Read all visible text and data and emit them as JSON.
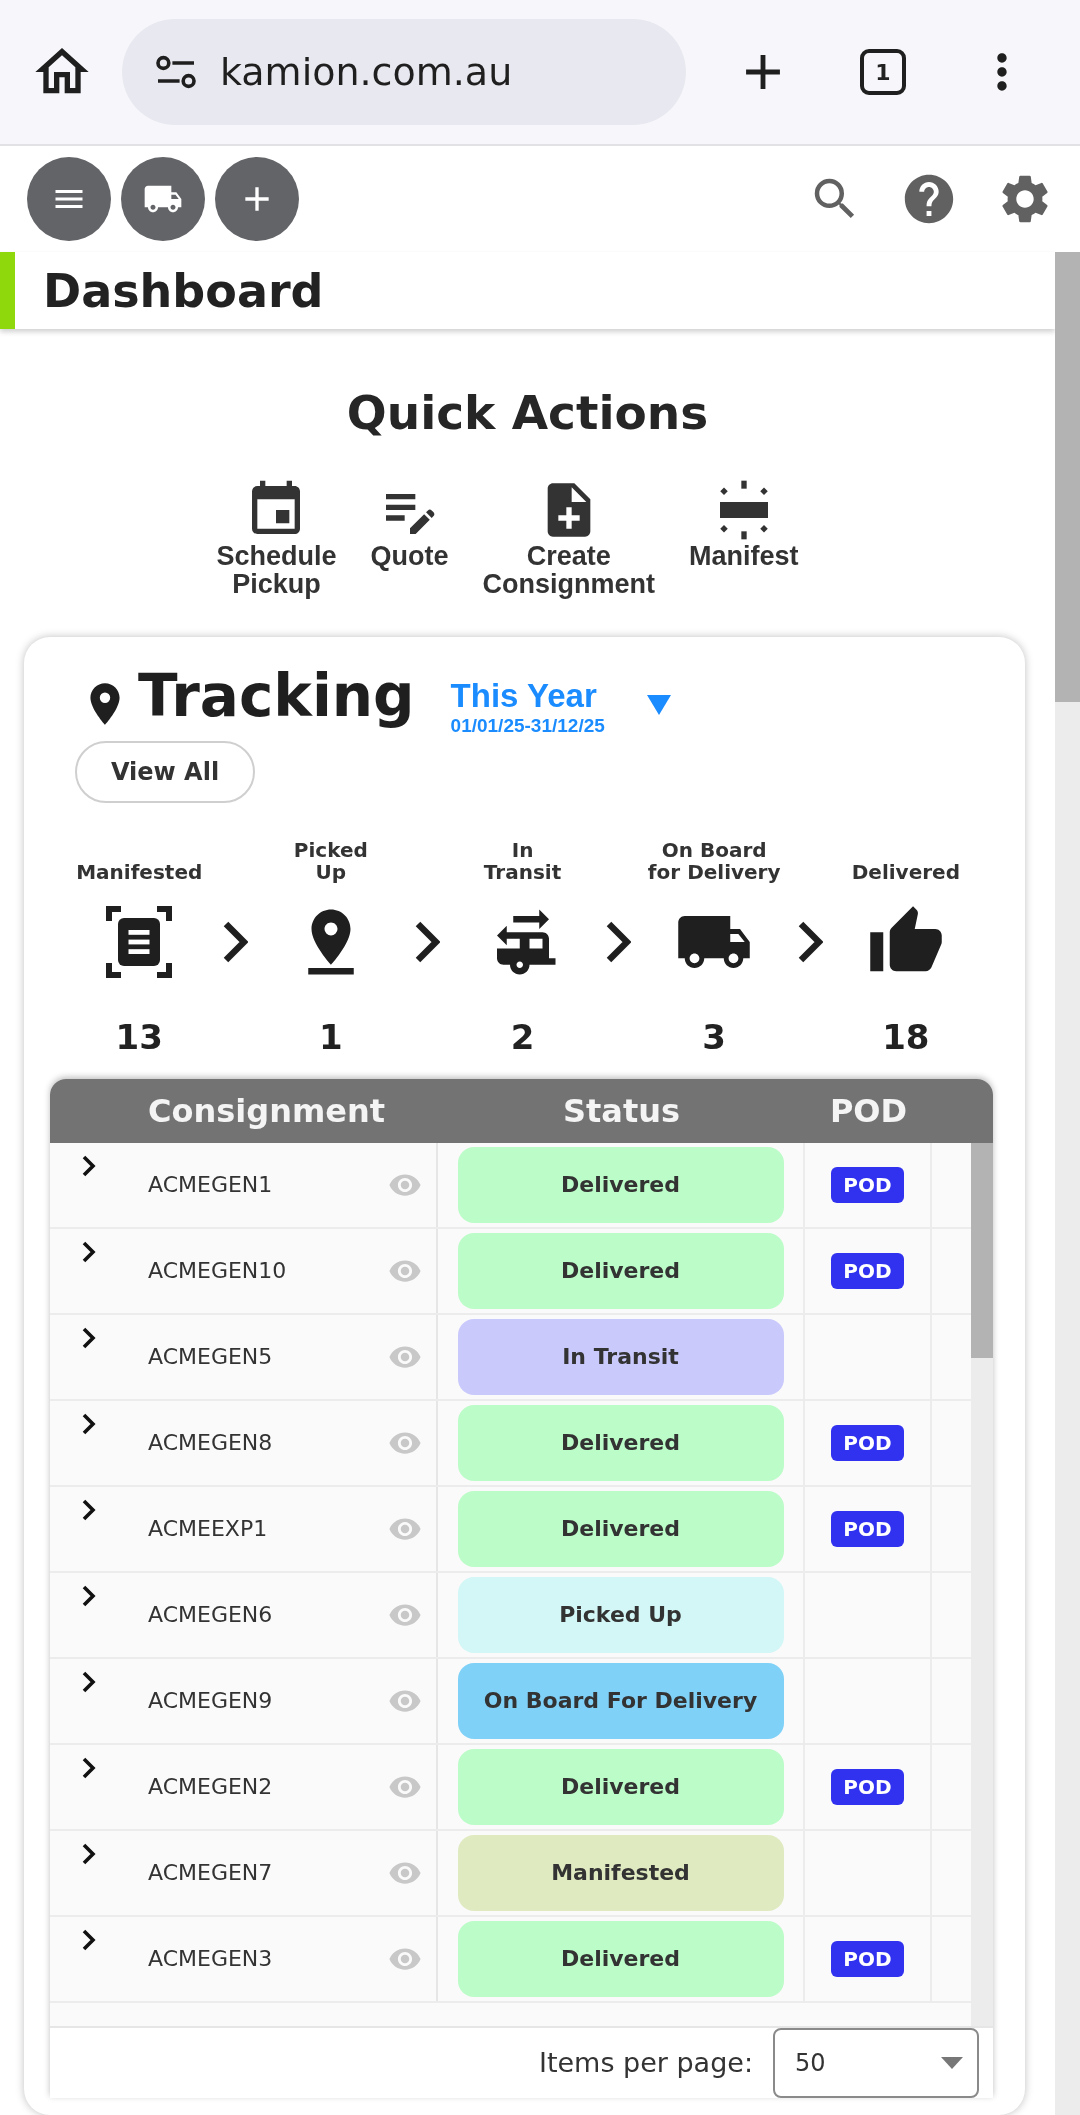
{
  "browser": {
    "url": "kamion.com.au",
    "tab_count": "1"
  },
  "page_title": "Dashboard",
  "quick_actions": {
    "title": "Quick Actions",
    "items": [
      {
        "kind": "schedule",
        "label": "Schedule Pickup"
      },
      {
        "kind": "quote",
        "label": "Quote"
      },
      {
        "kind": "create",
        "label": "Create Consignment"
      },
      {
        "kind": "manifest",
        "label": "Manifest"
      }
    ]
  },
  "tracking": {
    "title": "Tracking",
    "period": "This Year",
    "date_range": "01/01/25-31/12/25",
    "view_all": "View All",
    "steps": [
      {
        "kind": "manifested",
        "label": "Manifested",
        "count": "13"
      },
      {
        "kind": "picked_up",
        "label": "Picked\nUp",
        "count": "1"
      },
      {
        "kind": "in_transit",
        "label": "In\nTransit",
        "count": "2"
      },
      {
        "kind": "on_board",
        "label": "On Board\nfor Delivery",
        "count": "3"
      },
      {
        "kind": "delivered",
        "label": "Delivered",
        "count": "18"
      }
    ],
    "table": {
      "columns": [
        "Consignment",
        "Status",
        "POD"
      ],
      "rows": [
        {
          "consignment": "ACMEGEN1",
          "status": "Delivered",
          "color": "#bcfcc8",
          "pod": "POD"
        },
        {
          "consignment": "ACMEGEN10",
          "status": "Delivered",
          "color": "#bcfcc8",
          "pod": "POD"
        },
        {
          "consignment": "ACMEGEN5",
          "status": "In Transit",
          "color": "#c9c9fc"
        },
        {
          "consignment": "ACMEGEN8",
          "status": "Delivered",
          "color": "#bcfcc8",
          "pod": "POD"
        },
        {
          "consignment": "ACMEEXP1",
          "status": "Delivered",
          "color": "#bcfcc8",
          "pod": "POD"
        },
        {
          "consignment": "ACMEGEN6",
          "status": "Picked Up",
          "color": "#d3f6f6"
        },
        {
          "consignment": "ACMEGEN9",
          "status": "On Board For Delivery",
          "color": "#80d1f8"
        },
        {
          "consignment": "ACMEGEN2",
          "status": "Delivered",
          "color": "#bcfcc8",
          "pod": "POD"
        },
        {
          "consignment": "ACMEGEN7",
          "status": "Manifested",
          "color": "#dfeac1"
        },
        {
          "consignment": "ACMEGEN3",
          "status": "Delivered",
          "color": "#bcfcc8",
          "pod": "POD"
        }
      ]
    },
    "pagination": {
      "label": "Items per page:",
      "value": "50"
    }
  }
}
